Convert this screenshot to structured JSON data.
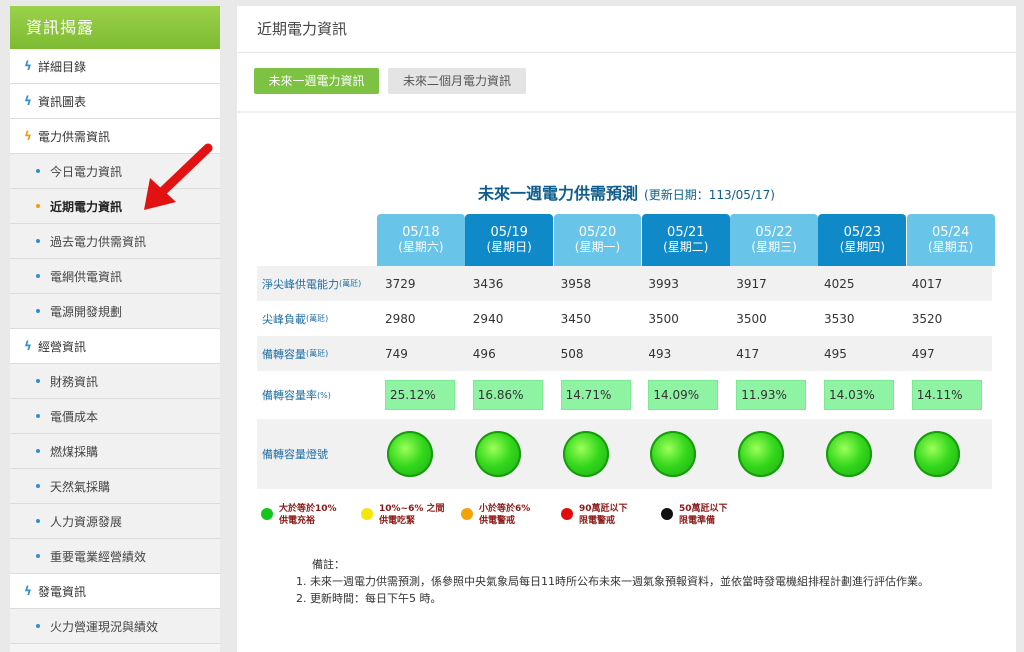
{
  "sidebar": {
    "header": "資訊揭露",
    "items": [
      {
        "label": "詳細目錄",
        "level": "top"
      },
      {
        "label": "資訊圖表",
        "level": "top"
      },
      {
        "label": "電力供需資訊",
        "level": "top",
        "accent": "orange"
      },
      {
        "label": "今日電力資訊",
        "level": "sub"
      },
      {
        "label": "近期電力資訊",
        "level": "sub",
        "active": true
      },
      {
        "label": "過去電力供需資訊",
        "level": "sub"
      },
      {
        "label": "電網供電資訊",
        "level": "sub"
      },
      {
        "label": "電源開發規劃",
        "level": "sub"
      },
      {
        "label": "經營資訊",
        "level": "top"
      },
      {
        "label": "財務資訊",
        "level": "sub"
      },
      {
        "label": "電價成本",
        "level": "sub"
      },
      {
        "label": "燃煤採購",
        "level": "sub"
      },
      {
        "label": "天然氣採購",
        "level": "sub"
      },
      {
        "label": "人力資源發展",
        "level": "sub"
      },
      {
        "label": "重要電業經營績效",
        "level": "sub"
      },
      {
        "label": "發電資訊",
        "level": "top"
      },
      {
        "label": "火力營運現況與績效",
        "level": "sub"
      }
    ]
  },
  "main": {
    "title": "近期電力資訊",
    "tabs": [
      {
        "label": "未來一週電力資訊",
        "active": true
      },
      {
        "label": "未來二個月電力資訊",
        "active": false
      }
    ],
    "forecast": {
      "title": "未來一週電力供需預測",
      "updated": "(更新日期：113/05/17)",
      "days": [
        {
          "date": "05/18",
          "weekday": "(星期六)"
        },
        {
          "date": "05/19",
          "weekday": "(星期日)"
        },
        {
          "date": "05/20",
          "weekday": "(星期一)"
        },
        {
          "date": "05/21",
          "weekday": "(星期二)"
        },
        {
          "date": "05/22",
          "weekday": "(星期三)"
        },
        {
          "date": "05/23",
          "weekday": "(星期四)"
        },
        {
          "date": "05/24",
          "weekday": "(星期五)"
        }
      ],
      "rows": [
        {
          "label": "淨尖峰供電能力",
          "unit": "(萬瓩)",
          "values": [
            "3729",
            "3436",
            "3958",
            "3993",
            "3917",
            "4025",
            "4017"
          ]
        },
        {
          "label": "尖峰負載",
          "unit": "(萬瓩)",
          "values": [
            "2980",
            "2940",
            "3450",
            "3500",
            "3500",
            "3530",
            "3520"
          ]
        },
        {
          "label": "備轉容量",
          "unit": "(萬瓩)",
          "values": [
            "749",
            "496",
            "508",
            "493",
            "417",
            "495",
            "497"
          ]
        },
        {
          "label": "備轉容量率",
          "unit": "(%)",
          "values": [
            "25.12%",
            "16.86%",
            "14.71%",
            "14.09%",
            "11.93%",
            "14.03%",
            "14.11%"
          ]
        },
        {
          "label": "備轉容量燈號",
          "unit": "",
          "values": [
            "green",
            "green",
            "green",
            "green",
            "green",
            "green",
            "green"
          ]
        }
      ]
    },
    "legend": [
      {
        "line1": "大於等於10%",
        "line2": "供電充裕",
        "color": "#12c61b"
      },
      {
        "line1": "10%~6% 之間",
        "line2": "供電吃緊",
        "color": "#f5e60a"
      },
      {
        "line1": "小於等於6%",
        "line2": "供電警戒",
        "color": "#f5a20a"
      },
      {
        "line1": "90萬瓩以下",
        "line2": "限電警戒",
        "color": "#e30b0b"
      },
      {
        "line1": "50萬瓩以下",
        "line2": "限電準備",
        "color": "#111111"
      }
    ],
    "notes": {
      "title": "備註：",
      "items": [
        "未來一週電力供需預測，係參照中央氣象局每日11時所公布未來一週氣象預報資料，並依當時發電機組排程計劃進行評估作業。",
        "更新時間：每日下午5 時。"
      ]
    }
  },
  "colors": {
    "accent_green": "#7dc242",
    "header_light": "#68c4e8",
    "header_dark": "#0f89c7",
    "title_blue": "#0e5d8c",
    "rate_green": "#8ef3a3"
  },
  "icons": [
    "lightning-bolt-icon",
    "bullet-dot-icon",
    "red-arrow-icon",
    "signal-light-icon"
  ]
}
